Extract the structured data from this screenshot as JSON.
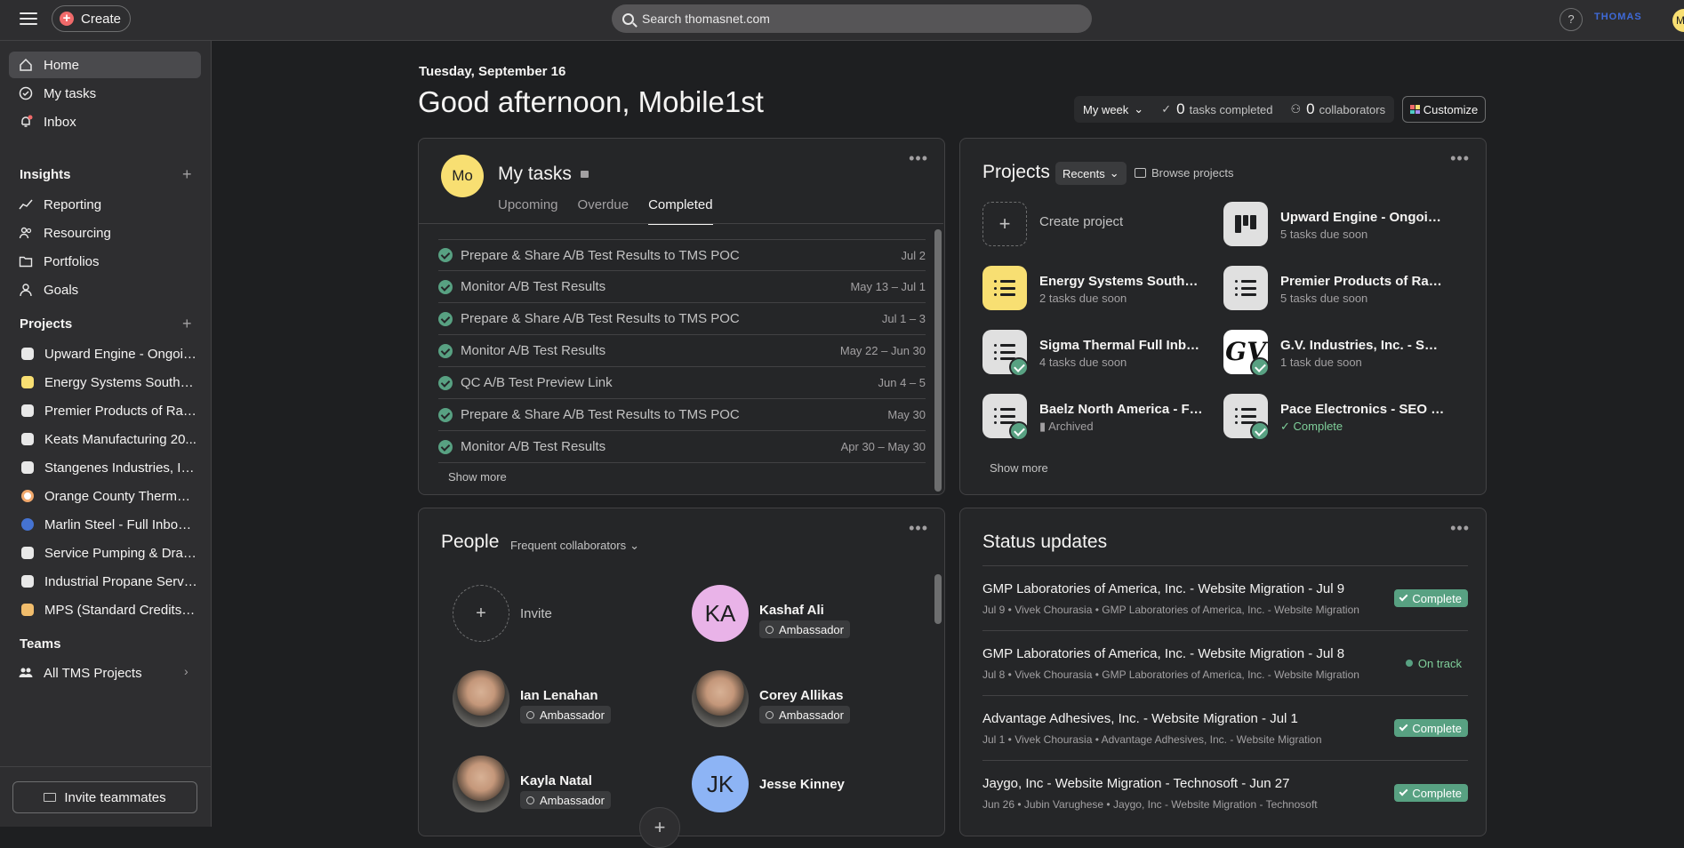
{
  "topbar": {
    "create_label": "Create",
    "search_placeholder": "Search thomasnet.com",
    "help_label": "?",
    "brand_text": "THOMAS",
    "avatar_initial": "M"
  },
  "sidebar": {
    "nav": [
      {
        "label": "Home",
        "icon": "home-icon"
      },
      {
        "label": "My tasks",
        "icon": "check-circle-icon"
      },
      {
        "label": "Inbox",
        "icon": "bell-icon"
      }
    ],
    "insights_heading": "Insights",
    "insights": [
      {
        "label": "Reporting",
        "icon": "chart-line-icon"
      },
      {
        "label": "Resourcing",
        "icon": "people-icon"
      },
      {
        "label": "Portfolios",
        "icon": "folder-icon"
      },
      {
        "label": "Goals",
        "icon": "person-icon"
      }
    ],
    "projects_heading": "Projects",
    "projects": [
      {
        "label": "Upward Engine - Ongoin...",
        "color": "#e8e8e8"
      },
      {
        "label": "Energy Systems Southea...",
        "color": "#f8df72"
      },
      {
        "label": "Premier Products of Raci...",
        "color": "#e8e8e8"
      },
      {
        "label": "Keats Manufacturing 20...",
        "color": "#e8e8e8"
      },
      {
        "label": "Stangenes Industries, In...",
        "color": "#e8e8e8"
      },
      {
        "label": "Orange County Thermal ...",
        "color": "#ffffff"
      },
      {
        "label": "Marlin Steel - Full Inboun...",
        "color": "#4573d2"
      },
      {
        "label": "Service Pumping & Drain...",
        "color": "#e8e8e8"
      },
      {
        "label": "Industrial Propane Servi...",
        "color": "#e8e8e8"
      },
      {
        "label": "MPS (Standard Credits P...",
        "color": "#f1bd6c"
      }
    ],
    "teams_heading": "Teams",
    "team_item": "All TMS Projects",
    "invite_label": "Invite teammates"
  },
  "main": {
    "date": "Tuesday, September 16",
    "greeting": "Good afternoon, Mobile1st",
    "my_week": "My week",
    "tasks_completed_count": "0",
    "tasks_completed_label": "tasks completed",
    "collaborators_count": "0",
    "collaborators_label": "collaborators",
    "customize_label": "Customize"
  },
  "my_tasks": {
    "avatar": "Mo",
    "title": "My tasks",
    "tabs": [
      "Upcoming",
      "Overdue",
      "Completed"
    ],
    "tasks": [
      {
        "name": "Prepare & Share A/B Test Results to TMS POC",
        "due": "Jul 2"
      },
      {
        "name": "Monitor A/B Test Results",
        "due": "May 13 – Jul 1"
      },
      {
        "name": "Prepare & Share A/B Test Results to TMS POC",
        "due": "Jul 1 – 3"
      },
      {
        "name": "Monitor A/B Test Results",
        "due": "May 22 – Jun 30"
      },
      {
        "name": "QC A/B Test Preview Link",
        "due": "Jun 4 – 5"
      },
      {
        "name": "Prepare & Share A/B Test Results to TMS POC",
        "due": "May 30"
      },
      {
        "name": "Monitor A/B Test Results",
        "due": "Apr 30 – May 30"
      }
    ],
    "show_more": "Show more"
  },
  "projects": {
    "title": "Projects",
    "recents": "Recents",
    "browse": "Browse projects",
    "create": "Create project",
    "items": [
      {
        "name": "Upward Engine - Ongoing...",
        "sub": "5 tasks due soon"
      },
      {
        "name": "Energy Systems Southea...",
        "sub": "2 tasks due soon"
      },
      {
        "name": "Premier Products of Raci...",
        "sub": "5 tasks due soon"
      },
      {
        "name": "Sigma Thermal Full Inbou...",
        "sub": "4 tasks due soon"
      },
      {
        "name": "G.V. Industries, Inc. - SEO...",
        "sub": "1 task due soon"
      },
      {
        "name": "Baelz North America - Ful...",
        "sub": "Archived"
      },
      {
        "name": "Pace Electronics - SEO Pr...",
        "sub": "Complete"
      }
    ],
    "gv_logo": "GV",
    "show_more": "Show more"
  },
  "people": {
    "title": "People",
    "filter": "Frequent collaborators",
    "invite": "Invite",
    "items": [
      {
        "name": "Kashaf Ali",
        "role": "Ambassador",
        "initials": "KA",
        "color": "#e9b3e8"
      },
      {
        "name": "Ian Lenahan",
        "role": "Ambassador"
      },
      {
        "name": "Corey Allikas",
        "role": "Ambassador"
      },
      {
        "name": "Kayla Natal",
        "role": "Ambassador"
      },
      {
        "name": "Jesse Kinney",
        "initials": "JK",
        "color": "#8db4f5"
      }
    ]
  },
  "status_updates": {
    "title": "Status updates",
    "items": [
      {
        "name": "GMP Laboratories of America, Inc. - Website Migration - Jul 9",
        "meta": "Jul 9 • Vivek Chourasia • GMP Laboratories of America, Inc. - Website Migration",
        "status": "Complete"
      },
      {
        "name": "GMP Laboratories of America, Inc. - Website Migration - Jul 8",
        "meta": "Jul 8 • Vivek Chourasia • GMP Laboratories of America, Inc. - Website Migration",
        "status": "On track"
      },
      {
        "name": "Advantage Adhesives, Inc. - Website Migration - Jul 1",
        "meta": "Jul 1 • Vivek Chourasia • Advantage Adhesives, Inc. - Website Migration",
        "status": "Complete"
      },
      {
        "name": "Jaygo, Inc - Website Migration - Technosoft - Jun 27",
        "meta": "Jun 26 • Jubin Varughese • Jaygo, Inc - Website Migration - Technosoft",
        "status": "Complete"
      }
    ]
  }
}
